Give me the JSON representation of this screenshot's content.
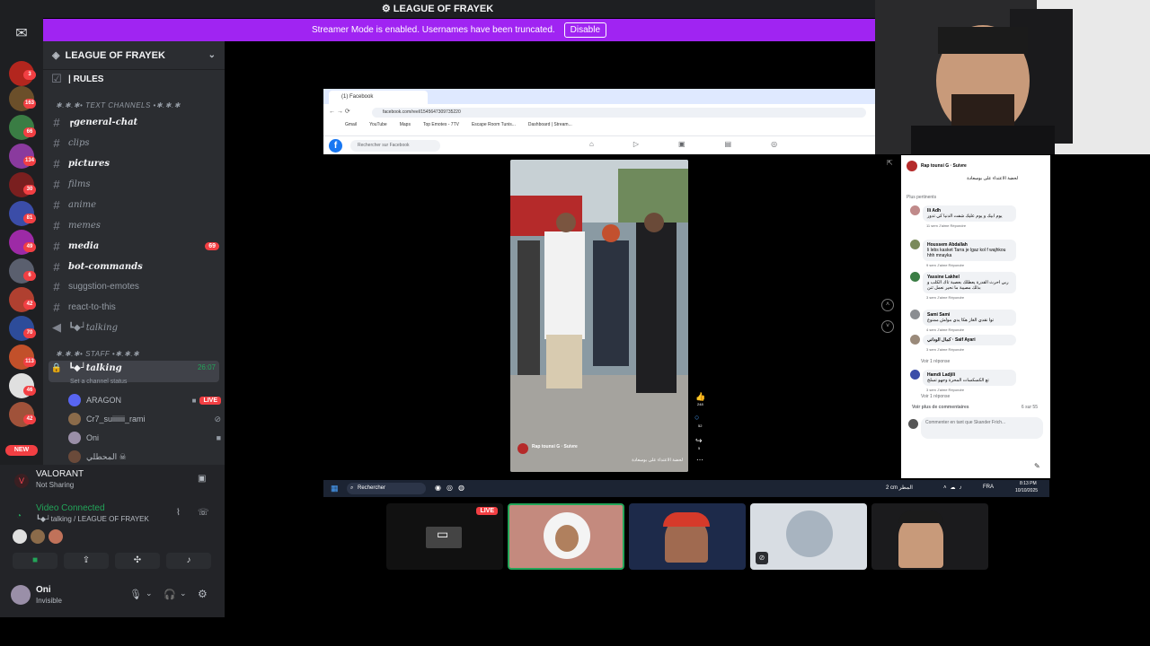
{
  "titlebar": {
    "title": "LEAGUE OF FRAYEK"
  },
  "streamer_banner": {
    "message": "Streamer Mode is enabled. Usernames have been truncated.",
    "button": "Disable"
  },
  "rail": {
    "badges": [
      "3",
      "163",
      "66",
      "134",
      "30",
      "81",
      "49",
      "6",
      "42",
      "70",
      "113",
      "46",
      "42"
    ],
    "new_label": "NEW"
  },
  "server": {
    "name": "LEAGUE OF FRAYEK"
  },
  "channels": {
    "rules": "| RULES",
    "text_category": "✱.✱.✱• TEXT CHANNELS •✱.✱.✱",
    "general": "┏general-chat",
    "clips": "clips",
    "pictures": "pictures",
    "films": "films",
    "anime": "anime",
    "memes": "memes",
    "media": "media",
    "media_badge": "69",
    "bot": "bot-commands",
    "suggestion": "suggstion-emotes",
    "react": "react-to-this",
    "talking1": "┗◆┘talking",
    "staff_category": "✱.✱.✱• STAFF •✱.✱.✱",
    "talking2": "┗◆┘talking",
    "talking2_time": "26:07",
    "channel_status": "Set a channel status"
  },
  "voice_users": [
    {
      "name": "ARAGON",
      "live": "LIVE"
    },
    {
      "name": "Cr7_suiiiiiii_rami"
    },
    {
      "name": "Oni"
    },
    {
      "name": "المحطلي ☠"
    }
  ],
  "activity": {
    "game": "VALORANT",
    "game_status": "Not Sharing",
    "connection": "Video Connected",
    "connection_detail": "┗◆┘talking / LEAGUE OF FRAYEK"
  },
  "user": {
    "name": "Oni",
    "status": "Invisible"
  },
  "browser": {
    "tab_title": "(1) Facebook",
    "url": "facebook.com/reel/1545647309735220",
    "bookmarks": [
      "Gmail",
      "YouTube",
      "Maps",
      "Top Emotes - 7TV",
      "Escape Room Tunis...",
      "Dashboard | Stream..."
    ],
    "search_placeholder": "Rechercher sur Facebook"
  },
  "reel": {
    "author": "Rap tounsi G · Suivre",
    "caption": "لحضة الاعتداء على بوسعادة",
    "like_count": "248",
    "comment_count": "52",
    "share_count": "5"
  },
  "comments_panel": {
    "header_author": "Rap tounsi G · Suivre",
    "header_caption": "لحضة الاعتداء على بوسعادة",
    "sort": "Plus pertinents",
    "comments": [
      {
        "author": "Ili Adh",
        "text": "يوم ابيك و يوم عليك شفت الدنيا كي تدور",
        "meta": "11 sem   J'aime   Répondre"
      },
      {
        "author": "Houssem Abdallah",
        "text": "li lebs kasket Tarra je lgaz kol f wajhkou hhh mnayka",
        "meta": "9 sem   J'aime   Répondre"
      },
      {
        "author": "Yassine Lakhel",
        "text": "ربي احرث القدرة يعطلك بعصبة تاك الكلب و بذلك مصيبة ما نحير نعمل ثنن",
        "meta": "3 sem   J'aime   Répondre"
      },
      {
        "author": "Sami Sami",
        "text": "توا نقدي الغاز هكا يدي مولش ممنوع",
        "meta": "4 sem   J'aime   Répondre"
      },
      {
        "author": "كمال الوداني · Saif Ayari",
        "text": "",
        "meta": "3 sem   J'aime   Répondre"
      },
      {
        "author": "Hamdi Ladjili",
        "text": "تع الكسكسات المحرة وجهو تسلخ",
        "meta": "3 sem   J'aime   Répondre"
      }
    ],
    "see_replies_1": "Voir 1 réponse",
    "see_replies_2": "Voir 1 réponse",
    "see_more": "Voir plus de commentaires",
    "count": "6 sur 55",
    "comment_placeholder": "Commenter en tant que Skander Frich..."
  },
  "taskbar": {
    "search": "Rechercher",
    "weather": "2 cm المطر",
    "lang": "FRA",
    "time": "8:13 PM",
    "date": "10/10/2025"
  },
  "participants": {
    "live_badge": "LIVE"
  },
  "colors": {
    "streamer": "#a024f2",
    "live": "#f23f43",
    "connected": "#23a559"
  }
}
